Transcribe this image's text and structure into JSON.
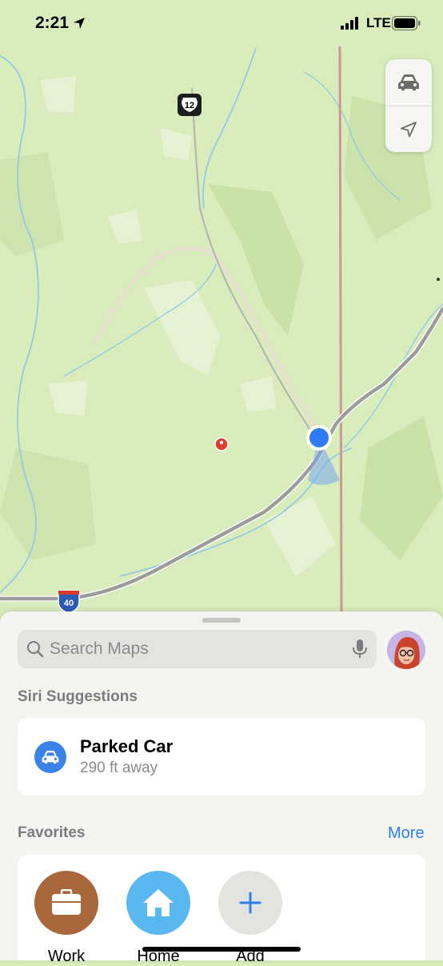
{
  "status_bar": {
    "time": "2:21",
    "network": "LTE"
  },
  "map": {
    "route_shields": [
      {
        "label": "12",
        "type": "state-highway"
      },
      {
        "label": "40",
        "type": "interstate"
      }
    ],
    "colors": {
      "terrain": "#d8ecbc",
      "highway": "#9c9c9c",
      "river": "#8fc7e8",
      "boundary": "#c79a94",
      "user_location": "#2f7bf5"
    }
  },
  "map_controls": {
    "top_icon": "car-icon",
    "bottom_icon": "location-arrow-icon"
  },
  "search": {
    "placeholder": "Search Maps"
  },
  "siri_suggestions": {
    "heading": "Siri Suggestions",
    "items": [
      {
        "title": "Parked Car",
        "subtitle": "290 ft away",
        "icon": "car-icon"
      }
    ]
  },
  "favorites": {
    "heading": "Favorites",
    "more_label": "More",
    "items": [
      {
        "label": "Work",
        "icon": "briefcase-icon",
        "color": "#a8683c"
      },
      {
        "label": "Home",
        "icon": "house-icon",
        "color": "#5ab8f0"
      },
      {
        "label": "Add",
        "icon": "plus-icon",
        "color": "#e3e3e0"
      }
    ]
  }
}
